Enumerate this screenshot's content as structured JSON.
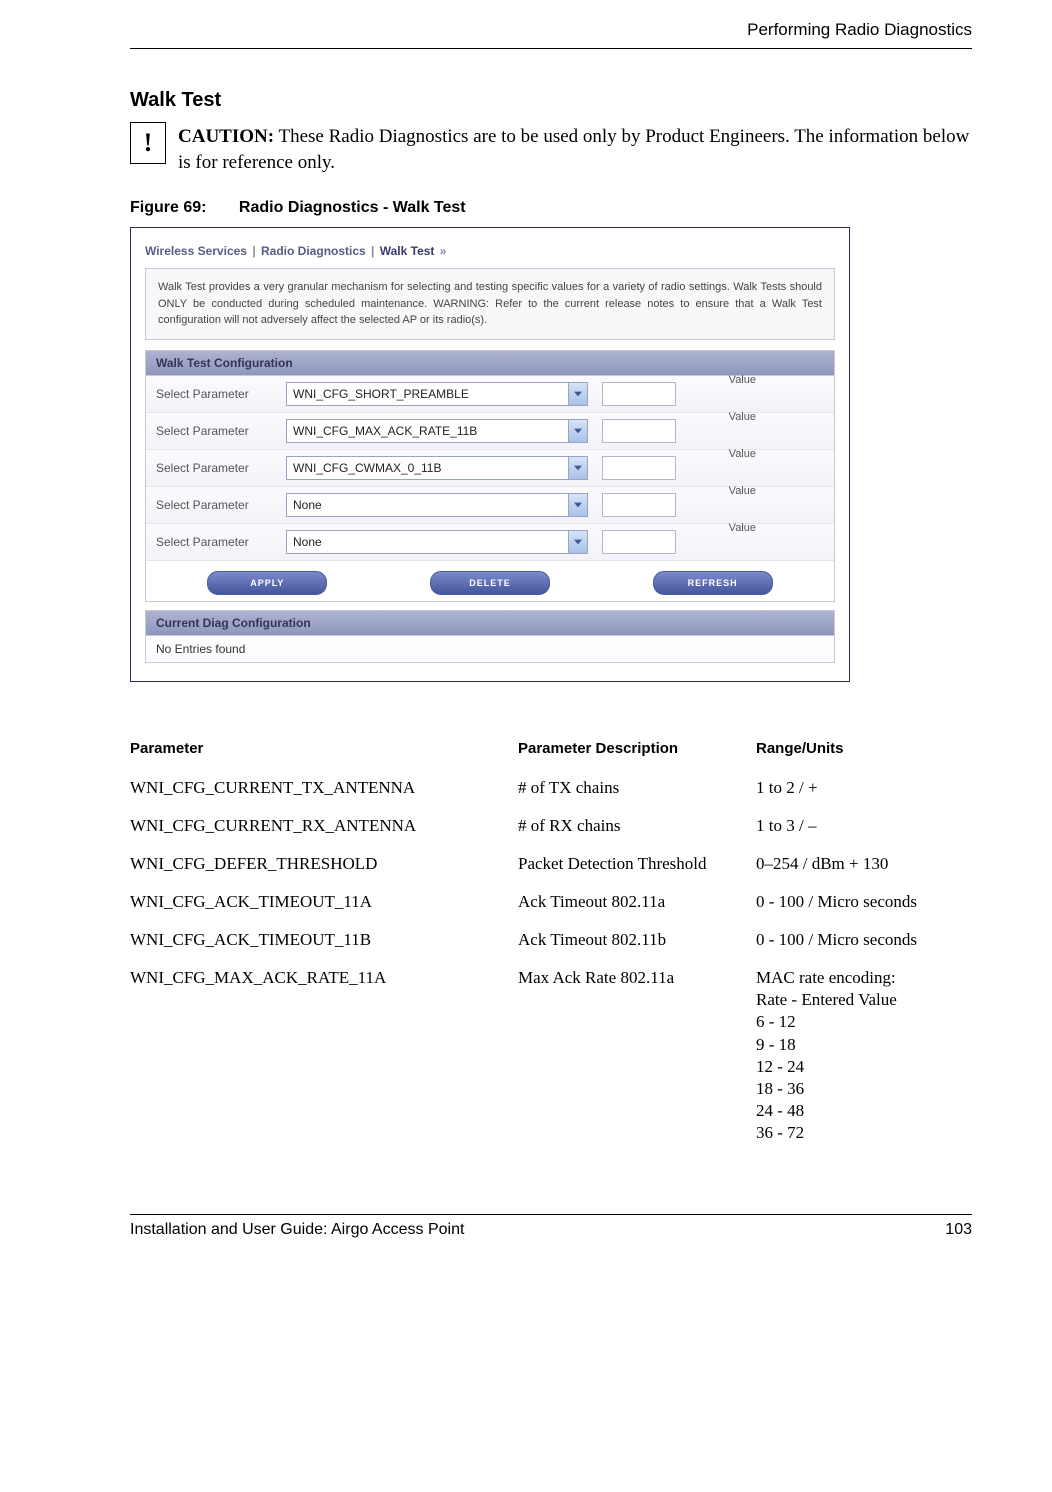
{
  "header": {
    "running_head": "Performing Radio Diagnostics"
  },
  "section": {
    "title": "Walk Test"
  },
  "caution": {
    "icon": "!",
    "label": "CAUTION:",
    "text": "These Radio Diagnostics are to be used only by Product Engineers. The information below is for reference only."
  },
  "figure": {
    "number": "Figure 69:",
    "title": "Radio Diagnostics - Walk Test"
  },
  "screenshot": {
    "breadcrumb": {
      "part1": "Wireless Services",
      "part2": "Radio Diagnostics",
      "part3": "Walk Test",
      "trail": "»"
    },
    "info_text": "Walk Test provides a very granular mechanism for selecting and testing specific values for a variety of radio settings. Walk Tests should ONLY be conducted during scheduled maintenance. WARNING: Refer to the current release notes to ensure that a Walk Test configuration will not adversely affect the selected AP or its radio(s).",
    "config_panel_title": "Walk Test Configuration",
    "rows": [
      {
        "label": "Select Parameter",
        "select_value": "WNI_CFG_SHORT_PREAMBLE",
        "value_label": "Value"
      },
      {
        "label": "Select Parameter",
        "select_value": "WNI_CFG_MAX_ACK_RATE_11B",
        "value_label": "Value"
      },
      {
        "label": "Select Parameter",
        "select_value": "WNI_CFG_CWMAX_0_11B",
        "value_label": "Value"
      },
      {
        "label": "Select Parameter",
        "select_value": "None",
        "value_label": "Value"
      },
      {
        "label": "Select Parameter",
        "select_value": "None",
        "value_label": "Value"
      }
    ],
    "buttons": {
      "apply": "APPLY",
      "delete": "DELETE",
      "refresh": "REFRESH"
    },
    "diag_panel_title": "Current Diag Configuration",
    "diag_status": "No Entries found"
  },
  "table": {
    "headers": {
      "parameter": "Parameter",
      "description": "Parameter Description",
      "range": "Range/Units"
    },
    "rows": [
      {
        "parameter": "WNI_CFG_CURRENT_TX_ANTENNA",
        "description": "# of TX chains",
        "range": "1 to 2 / +"
      },
      {
        "parameter": "WNI_CFG_CURRENT_RX_ANTENNA",
        "description": "# of RX chains",
        "range": "1 to 3 / –"
      },
      {
        "parameter": "WNI_CFG_DEFER_THRESHOLD",
        "description": "Packet Detection Threshold",
        "range": "0–254 / dBm + 130"
      },
      {
        "parameter": "WNI_CFG_ACK_TIMEOUT_11A",
        "description": "Ack Timeout 802.11a",
        "range": "0 - 100 / Micro seconds"
      },
      {
        "parameter": "WNI_CFG_ACK_TIMEOUT_11B",
        "description": "Ack Timeout 802.11b",
        "range": "0 - 100 / Micro seconds"
      },
      {
        "parameter": "WNI_CFG_MAX_ACK_RATE_11A",
        "description": "Max Ack Rate 802.11a",
        "range": "MAC rate encoding:\nRate - Entered Value\n6 - 12\n9 - 18\n12 - 24\n18 - 36\n24 - 48\n36 - 72"
      }
    ]
  },
  "footer": {
    "left": "Installation and User Guide: Airgo Access Point",
    "right": "103"
  }
}
